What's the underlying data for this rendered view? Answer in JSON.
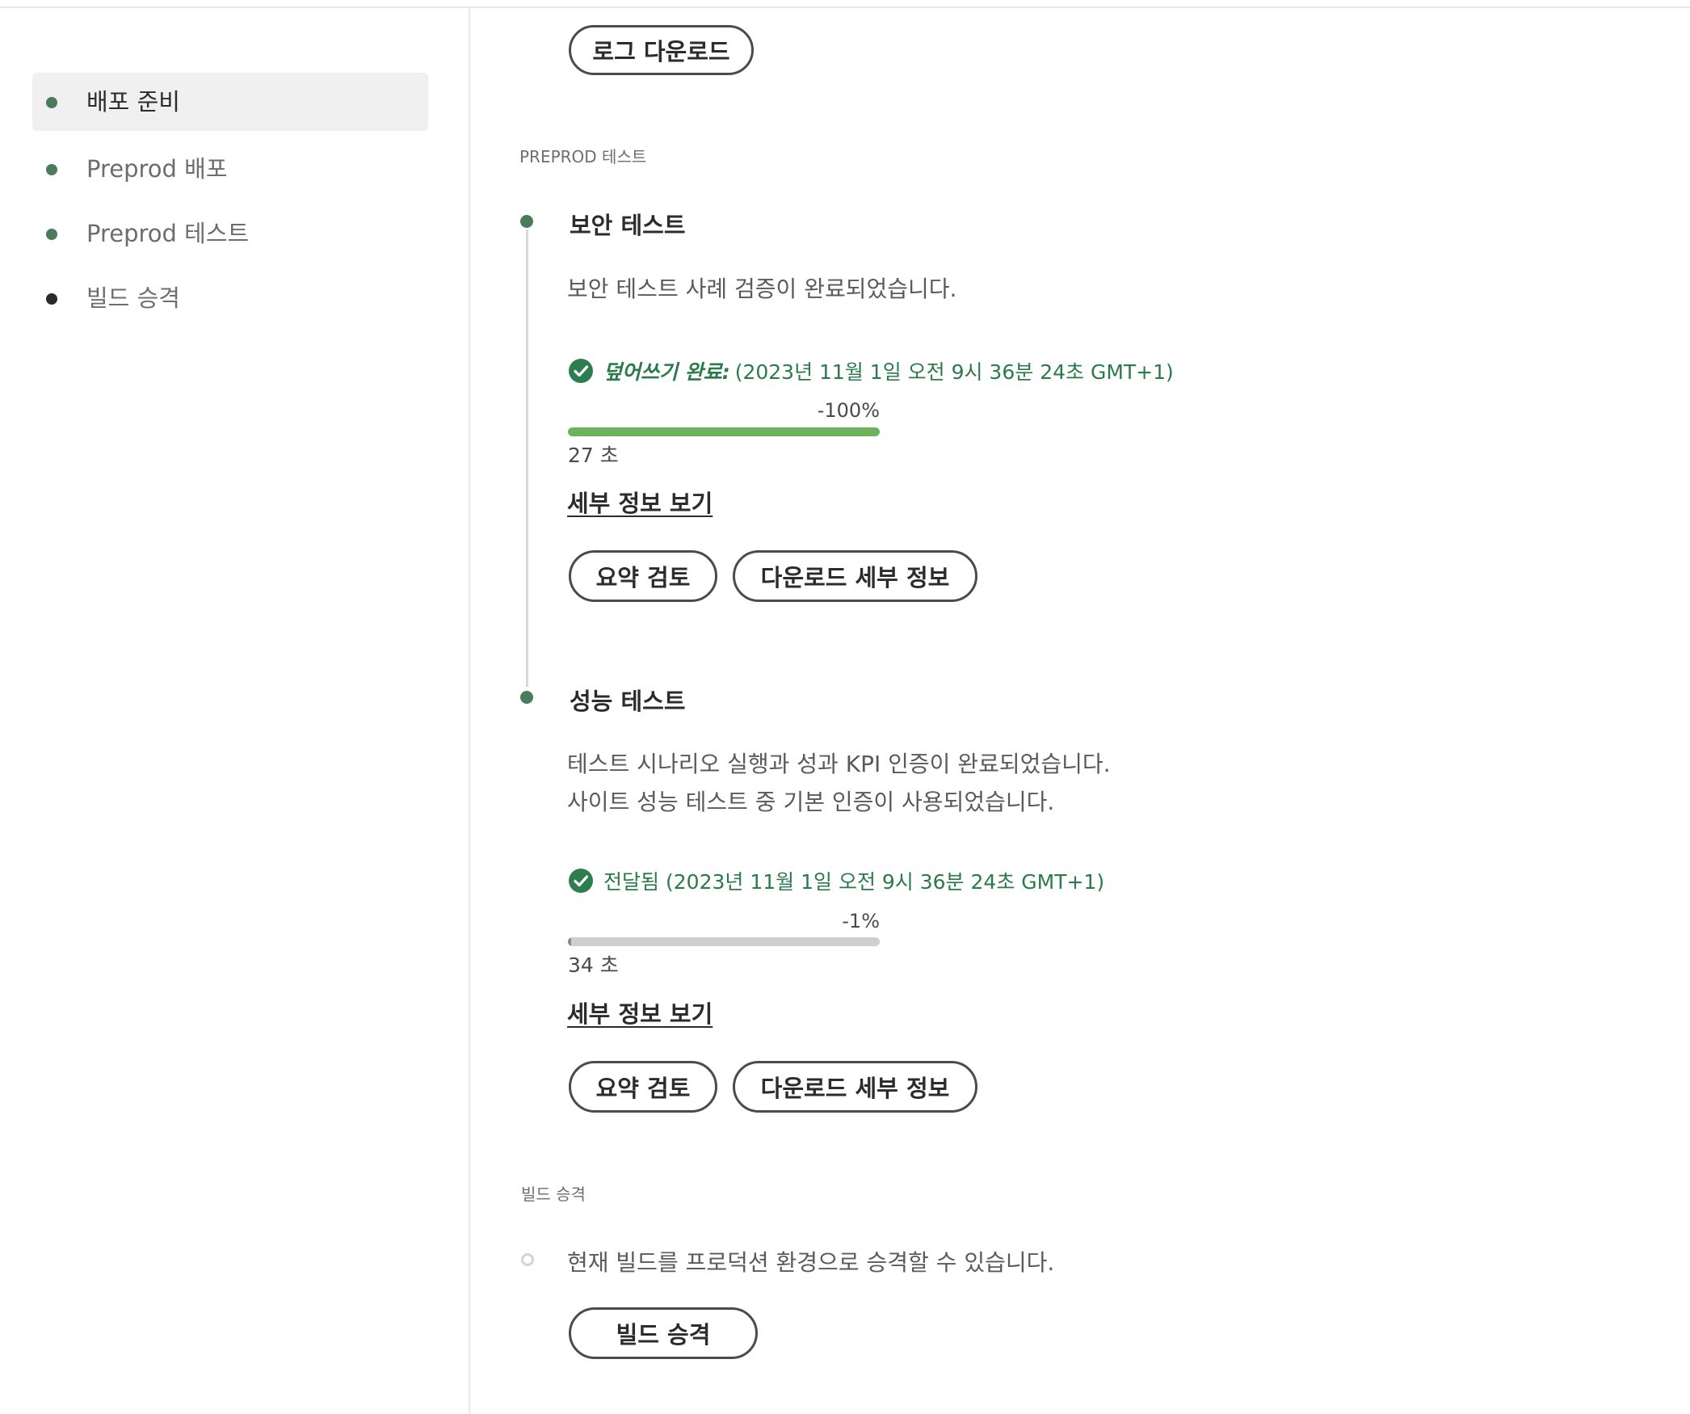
{
  "theme": {
    "accent": "#4a7c59",
    "success_text": "#2a7a4a",
    "bar_green": "#6cb35a",
    "bar_grey": "#cfcfcf"
  },
  "sidebar": {
    "items": [
      {
        "label": "배포 준비",
        "dot_color": "#4a7c59",
        "active": true
      },
      {
        "label": "Preprod 배포",
        "dot_color": "#4a7c59",
        "active": false
      },
      {
        "label": "Preprod 테스트",
        "dot_color": "#4a7c59",
        "active": false
      },
      {
        "label": "빌드 승격",
        "dot_color": "#2b2b2b",
        "active": false
      }
    ]
  },
  "top": {
    "log_download_label": "로그 다운로드"
  },
  "preprod_tests": {
    "section_label": "PREPROD 테스트",
    "security": {
      "title": "보안 테스트",
      "description": "보안 테스트 사례 검증이 완료되었습니다.",
      "status_label": "덮어쓰기 완료:",
      "timestamp": "(2023년 11월 1일 오전 9시 36분 24초 GMT+1)",
      "percent": "-100%",
      "progress": 1.0,
      "duration": "27 초",
      "details_link": "세부 정보 보기",
      "review_button": "요약 검토",
      "download_button": "다운로드 세부 정보"
    },
    "performance": {
      "title": "성능 테스트",
      "description_line1": "테스트 시나리오 실행과 성과 KPI 인증이 완료되었습니다.",
      "description_line2": "사이트 성능 테스트 중 기본 인증이 사용되었습니다.",
      "status_label": "전달됨",
      "timestamp": "(2023년 11월 1일 오전 9시 36분 24초 GMT+1)",
      "percent": "-1%",
      "progress": 0.01,
      "duration": "34 초",
      "details_link": "세부 정보 보기",
      "review_button": "요약 검토",
      "download_button": "다운로드 세부 정보"
    }
  },
  "promotion": {
    "section_label": "빌드 승격",
    "description": "현재 빌드를 프로덕션 환경으로 승격할 수 있습니다.",
    "button_label": "빌드 승격"
  },
  "icons": {
    "nav_dot": "dot-icon",
    "status_check": "check-circle-icon"
  }
}
